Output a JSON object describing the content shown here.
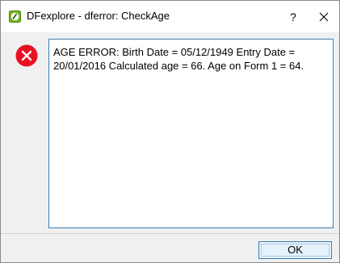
{
  "window": {
    "title": "DFexplore - dferror: CheckAge",
    "app_icon": "dfexplore-logo-icon",
    "help_label": "?",
    "close_icon": "close-icon"
  },
  "dialog": {
    "icon": "error-icon",
    "icon_color": "#e81123",
    "message": "AGE ERROR: Birth Date = 05/12/1949 Entry Date = 20/01/2016 Calculated age = 66. Age on Form 1 = 64.",
    "ok_label": "OK"
  },
  "colors": {
    "accent": "#3c7fb1",
    "logo_green": "#78b41e"
  }
}
